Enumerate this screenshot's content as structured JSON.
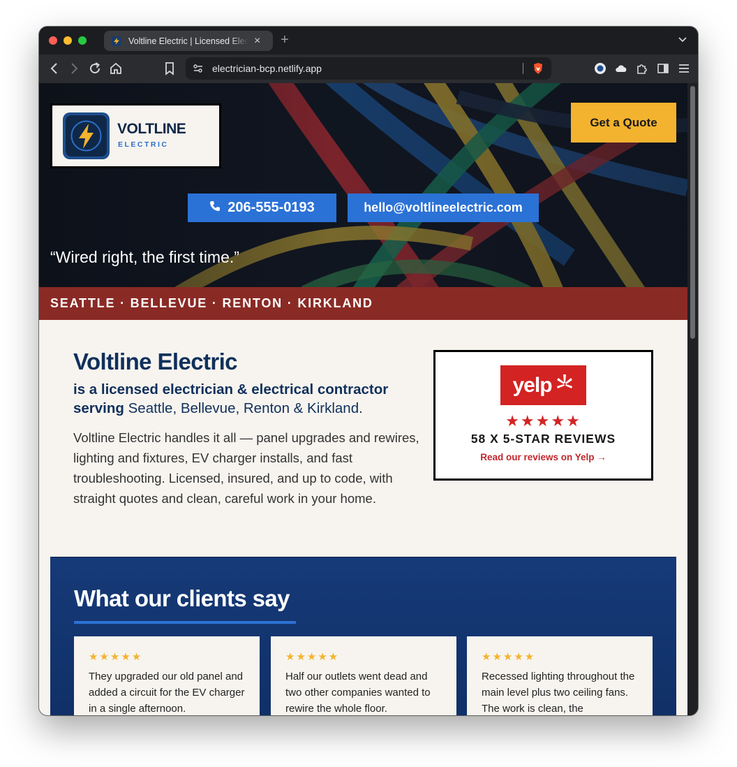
{
  "browser": {
    "tab_title": "Voltline Electric | Licensed Electrician",
    "url": "electrician-bcp.netlify.app",
    "new_tab_label": "+"
  },
  "hero": {
    "logo_name": "VOLTLINE",
    "logo_sub": "ELECTRIC",
    "quote_button": "Get a Quote",
    "phone": "206-555-0193",
    "email": "hello@voltlineelectric.com",
    "tagline": "“Wired right, the first time.”",
    "cities": "SEATTLE · BELLEVUE · RENTON · KIRKLAND"
  },
  "intro": {
    "title": "Voltline Electric",
    "subtitle_prefix": "is a licensed electrician & electrical contractor serving ",
    "subtitle_cities": "Seattle, Bellevue, Renton & Kirkland.",
    "body": "Voltline Electric handles it all — panel upgrades and rewires, lighting and fixtures, EV charger installs, and fast troubleshooting. Licensed, insured, and up to code, with straight quotes and clean, careful work in your home."
  },
  "yelp": {
    "logo_text": "yelp",
    "stars": "★★★★★",
    "rating": 5,
    "count_label": "58 X 5-STAR REVIEWS",
    "link": "Read our reviews on Yelp →"
  },
  "testimonials": {
    "title": "What our clients say",
    "items": [
      {
        "stars": "★★★★★",
        "text": "They upgraded our old panel and added a circuit for the EV charger in a single afternoon."
      },
      {
        "stars": "★★★★★",
        "text": "Half our outlets went dead and two other companies wanted to rewire the whole floor."
      },
      {
        "stars": "★★★★★",
        "text": "Recessed lighting throughout the main level plus two ceiling fans. The work is clean, the"
      }
    ]
  },
  "colors": {
    "navy": "#10305c",
    "accent_blue": "#2b72d6",
    "quote_yellow": "#f3b32e",
    "cities_red": "#8a2a25",
    "yelp_red": "#d32323"
  }
}
